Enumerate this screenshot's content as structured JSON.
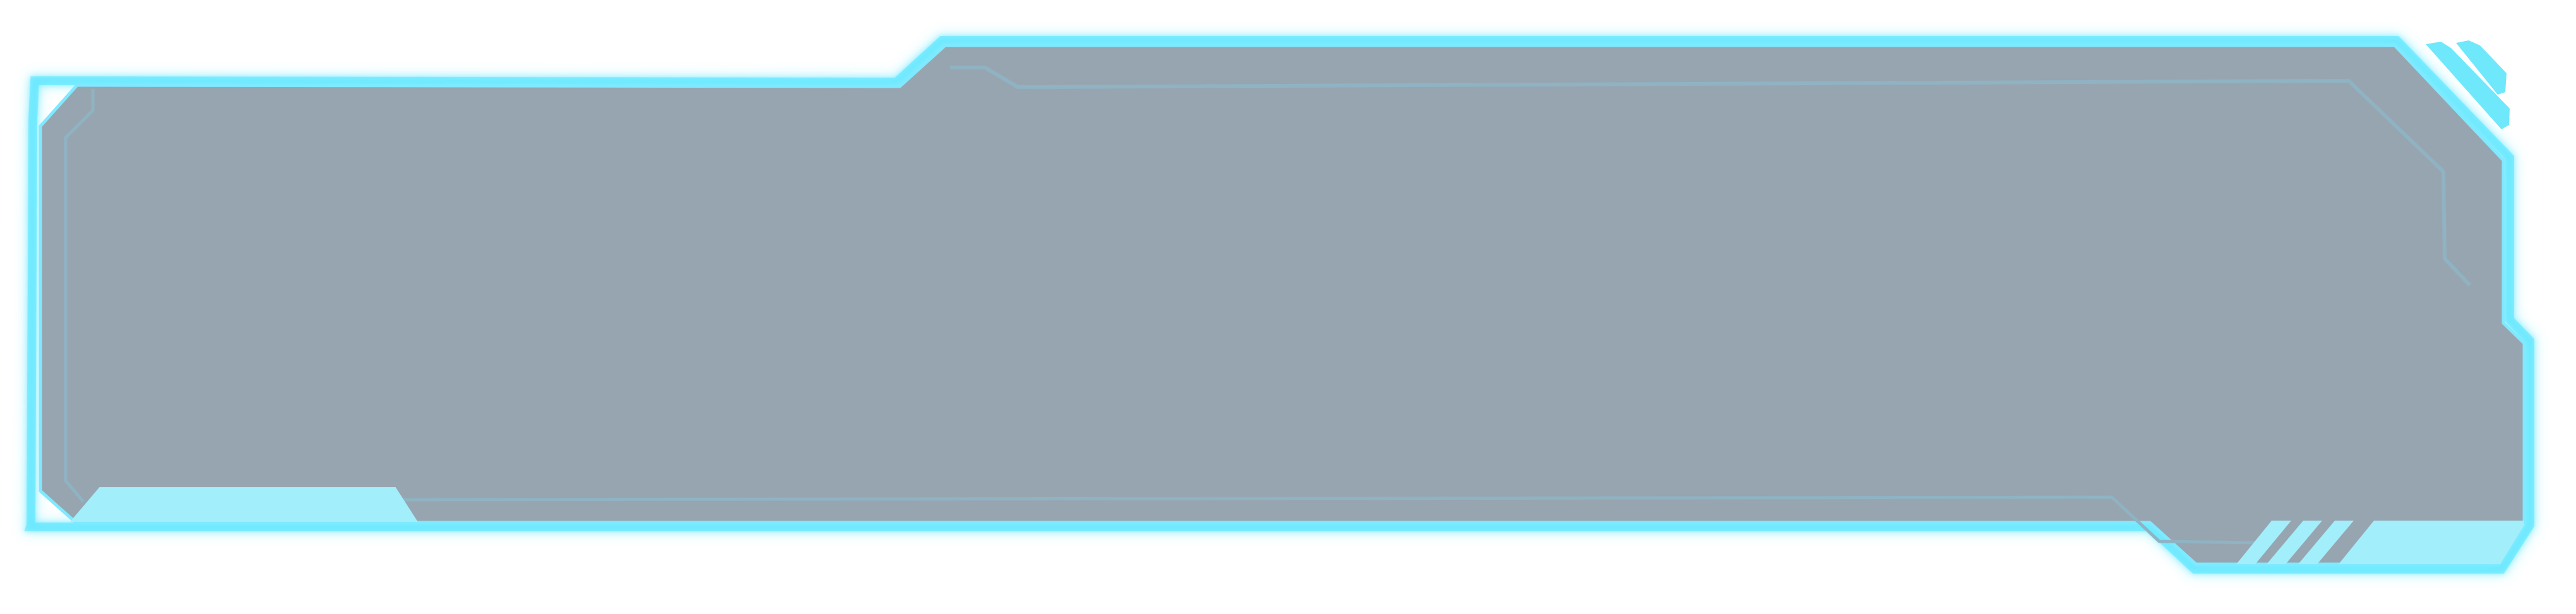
{
  "panel": {
    "fill_color": "#97a5b0",
    "glow_color": "#55e6ff",
    "border_color": "#7fe9ff",
    "accent_color": "#a2eefb",
    "inner_line_color": "#8fb3c3",
    "top_right_stripes": 2,
    "bottom_right_stripes": 3
  }
}
